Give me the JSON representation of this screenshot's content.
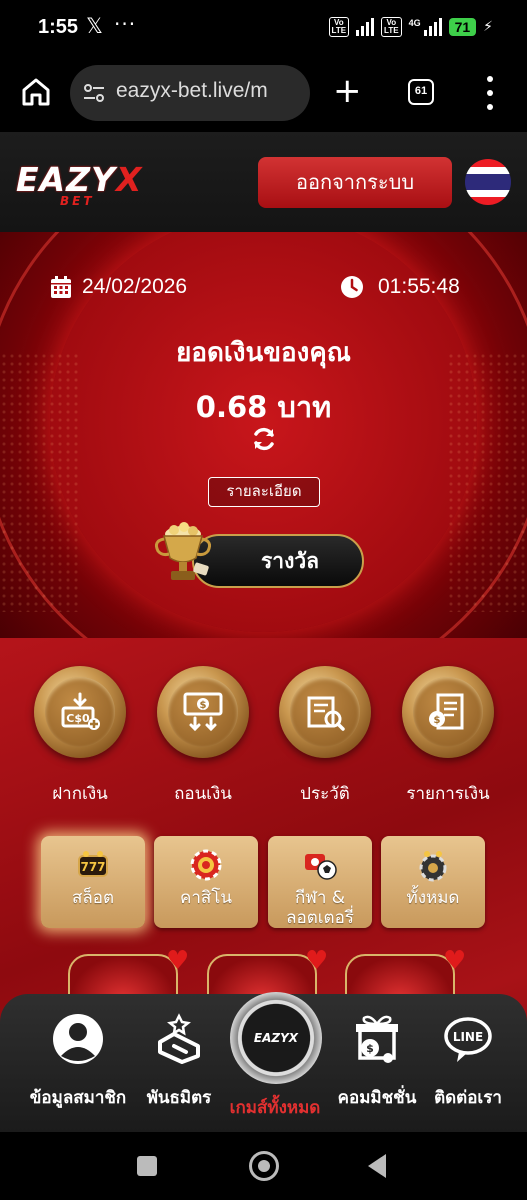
{
  "status_bar": {
    "time": "1:55",
    "x_label": "𝕏",
    "more": "···",
    "network_1": "Vo LTE",
    "network_2": "Vo LTE",
    "network_type": "4G",
    "battery": "71",
    "battery_icon": "battery-icon"
  },
  "browser": {
    "url": "eazyx-bet.live/m",
    "tabs_count": "61",
    "new_tab": "+"
  },
  "header": {
    "logo_main": "EAZY",
    "logo_x": "X",
    "logo_sub": "BET",
    "logout_label": "ออกจากระบบ",
    "flag_icon": "thailand-flag-icon"
  },
  "hero": {
    "date": "24/02/2026",
    "time": "01:55:48",
    "balance_label": "ยอดเงินของคุณ",
    "balance_value": "0.68 บาท",
    "detail_label": "รายละเอียด",
    "reward_label": "รางวัล"
  },
  "menu": {
    "items": [
      {
        "label": "ฝากเงิน",
        "icon": "deposit-icon"
      },
      {
        "label": "ถอนเงิน",
        "icon": "withdraw-icon"
      },
      {
        "label": "ประวัติ",
        "icon": "history-icon"
      },
      {
        "label": "รายการเงิน",
        "icon": "transactions-icon"
      }
    ]
  },
  "categories": [
    {
      "label": "สล็อต",
      "icon": "slot-icon",
      "active": true
    },
    {
      "label": "คาสิโน",
      "icon": "casino-icon",
      "active": false
    },
    {
      "label_line1": "กีฬา &",
      "label_line2": "ลอตเตอรี่",
      "icon": "sports-icon",
      "active": false
    },
    {
      "label": "ทั้งหมด",
      "icon": "all-games-icon",
      "active": false
    }
  ],
  "bottom_nav": {
    "items": [
      {
        "label": "ข้อมูลสมาชิก",
        "icon": "profile-icon"
      },
      {
        "label": "พันธมิตร",
        "icon": "partner-icon"
      },
      {
        "label": "เกมส์ทั้งหมด",
        "icon": "all-games-chip-icon",
        "chip_text": "EAZYX"
      },
      {
        "label": "คอมมิชชั่น",
        "icon": "commission-icon"
      },
      {
        "label": "ติดต่อเรา",
        "icon": "line-chat-icon",
        "badge": "LINE"
      }
    ]
  },
  "colors": {
    "accent_red": "#b5141a",
    "gold": "#c9974f",
    "header_bg": "#1d1d1d"
  }
}
